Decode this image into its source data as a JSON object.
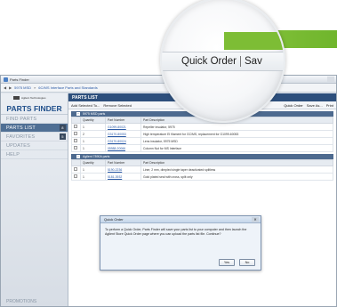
{
  "window": {
    "title": "Parts Finder"
  },
  "breadcrumb": {
    "back": "◀",
    "forward": "▶",
    "items": [
      "5975 MSD",
      "6C/MS Interface Parts and Standards"
    ]
  },
  "brand": {
    "company": "Agilent Technologies",
    "app_name": "PARTS FINDER"
  },
  "sidebar": {
    "items": [
      {
        "label": "FIND PARTS",
        "badge": ""
      },
      {
        "label": "PARTS LIST",
        "badge": "8"
      },
      {
        "label": "FAVORITES",
        "badge": "5"
      },
      {
        "label": "UPDATES",
        "badge": ""
      },
      {
        "label": "HELP",
        "badge": ""
      }
    ],
    "promo": "PROMOTIONS"
  },
  "main": {
    "header": "PARTS LIST",
    "toolbar": {
      "add": "Add Selected To...",
      "remove": "Remove Selected",
      "quick_order": "Quick Order",
      "save_as": "Save As...",
      "print": "Print"
    },
    "columns": [
      "",
      "Quantity",
      "Part Number",
      "Part Description"
    ],
    "sections": [
      {
        "title": "5975 MSD parts",
        "rows": [
          [
            "1",
            "G1099-80021",
            "Repeller insulator, 5975"
          ],
          [
            "2",
            "G3170-80053",
            "High temperature EI filament for GC/MS, replacement for G1099-60053"
          ],
          [
            "1",
            "G3170-80024",
            "Lens insulator, 5975 MSD"
          ],
          [
            "1",
            "05988-20066",
            "Column Nut for MS Interface"
          ]
        ]
      },
      {
        "title": "Agilent 7890A parts",
        "rows": [
          [
            "1",
            "5190-2236",
            "Liner, 2 mm, dimpled single taper deactivated splitless"
          ],
          [
            "1",
            "5181-3932",
            "Gold plated seal with cross, split only"
          ]
        ]
      }
    ]
  },
  "dialog": {
    "title": "Quick Order",
    "message": "To perform a Quick Order, Parts Finder will save your parts list to your computer and then launch the Agilent Store Quick Order page where you can upload the parts list file. Continue?",
    "yes": "Yes",
    "no": "No"
  },
  "magnifier": {
    "quick_order": "Quick Order",
    "save": "Sav"
  }
}
